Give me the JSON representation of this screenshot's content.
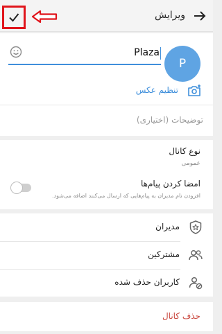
{
  "colors": {
    "accent": "#3f8fdb",
    "avatar": "#5fa4e3",
    "danger": "#c9463d",
    "annotation": "#e0141b"
  },
  "header": {
    "title": "ویرایش",
    "done_icon": "check-icon",
    "back_icon": "arrow-right-icon"
  },
  "profile": {
    "avatar_letter": "P",
    "name_value": "Plaza",
    "emoji_icon": "emoji-icon",
    "set_photo_label": "تنظیم عکس",
    "camera_icon": "camera-add-icon",
    "description_placeholder": "توضیحات (اختیاری)"
  },
  "channel_settings": {
    "type_title": "نوع کانال",
    "type_value": "عمومی",
    "sign_title": "امضا کردن پیام‌ها",
    "sign_description": "افزودن نام مدیران به پیام‌هایی که ارسال می‌کنند اضافه می‌شود.",
    "sign_enabled": false
  },
  "menu": [
    {
      "label": "مدیران",
      "icon": "admin-star-icon"
    },
    {
      "label": "مشترکین",
      "icon": "users-icon"
    },
    {
      "label": "کاربران حذف شده",
      "icon": "blocked-user-icon"
    }
  ],
  "delete_label": "حذف کانال"
}
